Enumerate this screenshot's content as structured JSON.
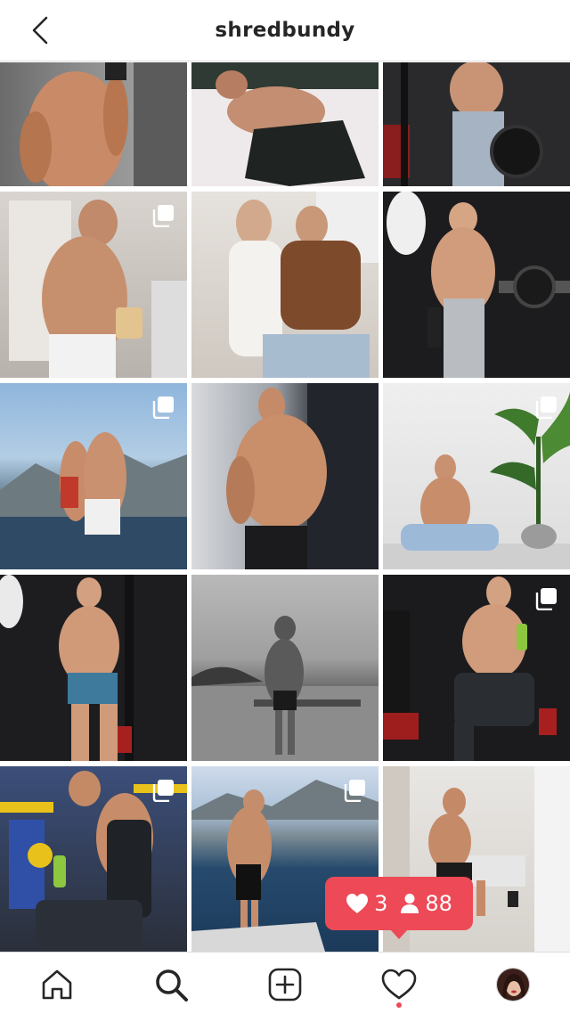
{
  "header": {
    "title": "shredbundy",
    "back_icon": "chevron-left-icon"
  },
  "notification": {
    "likes": "3",
    "followers": "88",
    "color": "#ed4956"
  },
  "tabbar": {
    "tabs": [
      "home-icon",
      "search-icon",
      "new-post-icon",
      "activity-heart-icon",
      "profile-avatar"
    ],
    "active_dot_color": "#ed4956"
  }
}
